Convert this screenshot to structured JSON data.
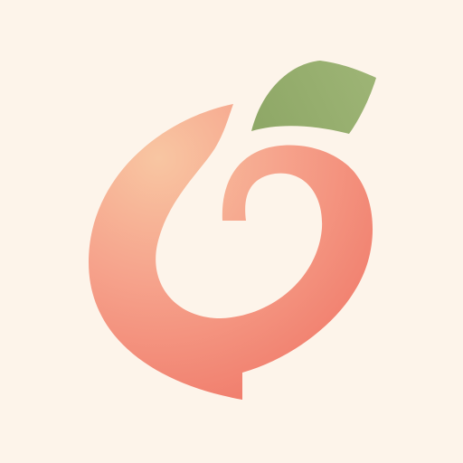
{
  "app_icon": {
    "name": "peach-logo",
    "colors": {
      "background": "#FDF4EA",
      "peach_light": "#F8C6A2",
      "peach_mid": "#F6A38C",
      "peach_deep": "#F07A6A",
      "leaf": "#96AD6E"
    }
  }
}
